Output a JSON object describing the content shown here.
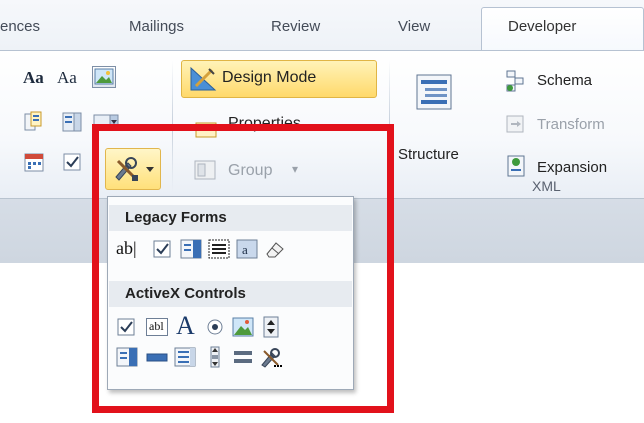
{
  "tabs": {
    "references": "ences",
    "mailings": "Mailings",
    "review": "Review",
    "view": "View",
    "developer": "Developer"
  },
  "controls": {
    "aa_rich_text": "Aa",
    "aa_plain_text": "Aa",
    "design_mode": "Design Mode",
    "properties": "Properties",
    "group": "Group",
    "group_arrow": "▾"
  },
  "xml": {
    "structure": "Structure",
    "schema": "Schema",
    "transform": "Transform",
    "expansion": "Expansion",
    "group_label": "XML"
  },
  "dropdown": {
    "legacy_heading": "Legacy Forms",
    "legacy_text_field_label": "ab|",
    "activex_heading": "ActiveX Controls",
    "activex_textbox_label": "abl",
    "activex_label_glyph": "A"
  },
  "colors": {
    "highlight": "#e2111b",
    "design_mode_bg": "#ffd96b"
  }
}
